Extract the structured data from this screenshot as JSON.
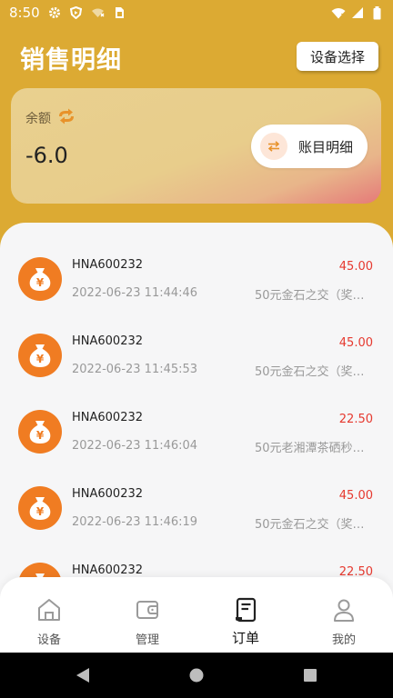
{
  "status_bar": {
    "time": "8:50",
    "icons": [
      "gear-icon",
      "shield-icon",
      "wifi-off-icon",
      "sim-card-icon",
      "wifi-icon",
      "signal-icon",
      "battery-icon"
    ]
  },
  "header": {
    "title": "销售明细",
    "device_select_label": "设备选择"
  },
  "balance": {
    "label": "余额",
    "value": "-6.0",
    "account_detail_label": "账目明细"
  },
  "orders": [
    {
      "id": "HNA600232",
      "time": "2022-06-23 11:44:46",
      "amount": "45.00",
      "desc": "50元金石之交（奖）..."
    },
    {
      "id": "HNA600232",
      "time": "2022-06-23 11:45:53",
      "amount": "45.00",
      "desc": "50元金石之交（奖）..."
    },
    {
      "id": "HNA600232",
      "time": "2022-06-23 11:46:04",
      "amount": "22.50",
      "desc": "50元老湘潭茶硒秒杀..."
    },
    {
      "id": "HNA600232",
      "time": "2022-06-23 11:46:19",
      "amount": "45.00",
      "desc": "50元金石之交（奖）..."
    },
    {
      "id": "HNA600232",
      "time": "",
      "amount": "22.50",
      "desc": ""
    }
  ],
  "bottom_nav": {
    "items": [
      {
        "label": "设备",
        "icon": "home-icon"
      },
      {
        "label": "管理",
        "icon": "wallet-icon"
      },
      {
        "label": "订单",
        "icon": "order-icon",
        "active": true
      },
      {
        "label": "我的",
        "icon": "user-icon"
      }
    ]
  },
  "colors": {
    "brand": "#dcaa33",
    "amount": "#e6392f",
    "order_icon": "#f07c22"
  }
}
